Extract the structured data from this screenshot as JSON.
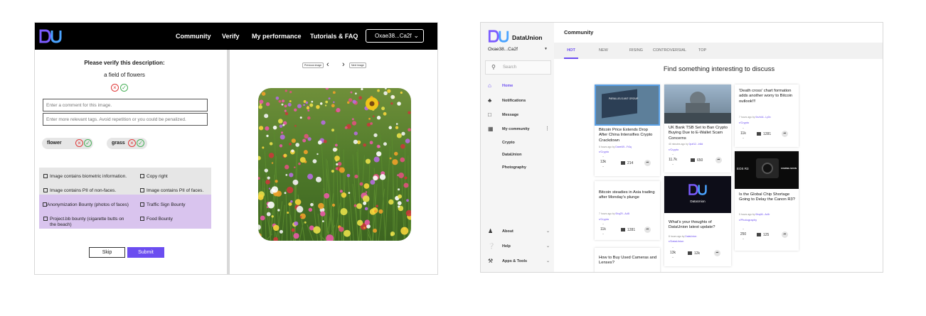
{
  "verify_app": {
    "logo": "DU",
    "nav": [
      "Community",
      "Verify",
      "My performance",
      "Tutorials & FAQ"
    ],
    "wallet": "Oxae38...Ca2f",
    "heading": "Please verify this description:",
    "description": "a field of flowers",
    "comment_placeholder": "Enter a comment for this image.",
    "tags_placeholder": "Enter more relevant tags. Avoid repetition or you could be penalized.",
    "tags": [
      "flower",
      "grass"
    ],
    "options": [
      "Image contains biometric information.",
      "Copy right",
      "Image contains PII of non-faces.",
      "Image contains PII of faces.",
      "Anonymization Bounty (photos of faces)",
      "Traffic Sign Bounty",
      "Project.bb bounty (cigarette butts on",
      "the beach)",
      "Food Bounty"
    ],
    "skip_label": "Skip",
    "submit_label": "Submit",
    "prev_label": "Previous image",
    "next_label": "Next image"
  },
  "community_app": {
    "brand": "DataUnion",
    "account": "Oxae38...Ca2f",
    "search_placeholder": "Search",
    "sidebar": {
      "home": "Home",
      "notifications": "Notifications",
      "message": "Message",
      "my_community": "My community",
      "communities": [
        "Crypto",
        "DataUnion",
        "Photography"
      ],
      "about": "About",
      "help": "Help",
      "apps": "Apps & Tools"
    },
    "title": "Community",
    "tabs": [
      "HOT",
      "NEW",
      "RISING",
      "CONTROVERSIAL",
      "TOP"
    ],
    "find_text": "Find something interesting to discuss",
    "posts": [
      {
        "title": "Bitcoin Price Extends Drop After China Intensifies Crypto Crackdown",
        "meta_prefix": "6 hours ago by",
        "user": "Dxeef49...Fr3q",
        "community": "r/Crypto",
        "votes": "13k",
        "comments": "214",
        "thumb_text": "PARALLELS ANT GROUP"
      },
      {
        "title": "UK Bank TSB Set to Ban Crypto Buying Due to E-Wallet Scam Concerns",
        "meta_prefix": "40 minutes ago by",
        "user": "0pzf12...In5d",
        "community": "r/Crypto",
        "votes": "11.7k",
        "comments": "650"
      },
      {
        "title": "'Death cross' chart formation adds another worry to Bitcoin outlook!!!",
        "meta_prefix": "7 hours ago by",
        "user": "0nzh44...Ly3n",
        "community": "r/Crypto",
        "votes": "11k",
        "comments": "1281"
      },
      {
        "title": "Bitcoin steadies in Asia trading after Monday's plunge",
        "meta_prefix": "7 hours ago by",
        "user": "0fcq29...Ao5i",
        "community": "r/Crypto",
        "votes": "11k",
        "comments": "1281"
      },
      {
        "title": "What's your thoughts of DataUnion latest update?",
        "meta_prefix": "8 hours ago by",
        "user": "DataUnion",
        "community": "r/DataUnion",
        "votes": "13k",
        "comments": "12k",
        "thumb_text": "DataUnion"
      },
      {
        "title": "Is the Global Chip Shortage Going to Delay the Canon R3?",
        "meta_prefix": "5 hours ago by",
        "user": "0fcq46...Ac5r",
        "community": "r/Photography",
        "votes": "250",
        "comments": "125",
        "thumb_left": "EOS R3",
        "thumb_right": "COMING SOON"
      },
      {
        "title": "How to Buy Used Cameras and Lenses?"
      }
    ]
  },
  "colors": {
    "accent": "#6b4df0",
    "verify_purple": "#d9c4ee",
    "reject": "#e03a3a",
    "approve": "#49b05a"
  }
}
